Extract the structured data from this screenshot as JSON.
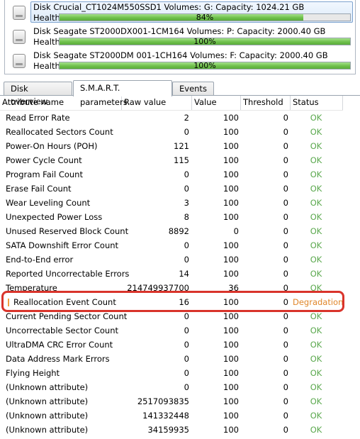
{
  "disks": [
    {
      "line": "Disk Crucial_CT1024M550SSD1   Volumes: G:   Capacity: 1024.21 GB",
      "health_label": "Health:",
      "health_text": "84%",
      "health": 0.84,
      "selected": true
    },
    {
      "line": "Disk Seagate ST2000DX001-1CM164   Volumes: P:   Capacity: 2000.40 GB",
      "health_label": "Health:",
      "health_text": "100%",
      "health": 1.0,
      "selected": false
    },
    {
      "line": "Disk Seagate ST2000DM 001-1CH164   Volumes: F:   Capacity: 2000.40 GB",
      "health_label": "Health:",
      "health_text": "100%",
      "health": 1.0,
      "selected": false
    }
  ],
  "tabs": [
    "Disk overview",
    "S.M.A.R.T. parameters",
    "Events"
  ],
  "active_tab": 1,
  "columns": {
    "name": "Attribute name",
    "raw": "Raw value",
    "value": "Value",
    "threshold": "Threshold",
    "status": "Status"
  },
  "rows": [
    {
      "name": "Read Error Rate",
      "raw": "2",
      "value": "100",
      "threshold": "0",
      "status": "OK"
    },
    {
      "name": "Reallocated Sectors Count",
      "raw": "0",
      "value": "100",
      "threshold": "0",
      "status": "OK"
    },
    {
      "name": "Power-On Hours (POH)",
      "raw": "121",
      "value": "100",
      "threshold": "0",
      "status": "OK"
    },
    {
      "name": "Power Cycle Count",
      "raw": "115",
      "value": "100",
      "threshold": "0",
      "status": "OK"
    },
    {
      "name": "Program Fail Count",
      "raw": "0",
      "value": "100",
      "threshold": "0",
      "status": "OK"
    },
    {
      "name": "Erase Fail Count",
      "raw": "0",
      "value": "100",
      "threshold": "0",
      "status": "OK"
    },
    {
      "name": "Wear Leveling Count",
      "raw": "3",
      "value": "100",
      "threshold": "0",
      "status": "OK"
    },
    {
      "name": "Unexpected Power Loss",
      "raw": "8",
      "value": "100",
      "threshold": "0",
      "status": "OK"
    },
    {
      "name": "Unused Reserved Block Count",
      "raw": "8892",
      "value": "0",
      "threshold": "0",
      "status": "OK"
    },
    {
      "name": "SATA Downshift Error Count",
      "raw": "0",
      "value": "100",
      "threshold": "0",
      "status": "OK"
    },
    {
      "name": "End-to-End error",
      "raw": "0",
      "value": "100",
      "threshold": "0",
      "status": "OK"
    },
    {
      "name": "Reported Uncorrectable Errors",
      "raw": "14",
      "value": "100",
      "threshold": "0",
      "status": "OK"
    },
    {
      "name": "Temperature",
      "raw": "214749937700",
      "value": "36",
      "threshold": "0",
      "status": "OK"
    },
    {
      "name": "Reallocation Event Count",
      "raw": "16",
      "value": "100",
      "threshold": "0",
      "status": "Degradation",
      "warning": true
    },
    {
      "name": "Current Pending Sector Count",
      "raw": "0",
      "value": "100",
      "threshold": "0",
      "status": "OK"
    },
    {
      "name": "Uncorrectable Sector Count",
      "raw": "0",
      "value": "100",
      "threshold": "0",
      "status": "OK"
    },
    {
      "name": "UltraDMA CRC Error Count",
      "raw": "0",
      "value": "100",
      "threshold": "0",
      "status": "OK"
    },
    {
      "name": "Data Address Mark Errors",
      "raw": "0",
      "value": "100",
      "threshold": "0",
      "status": "OK"
    },
    {
      "name": "Flying Height",
      "raw": "0",
      "value": "100",
      "threshold": "0",
      "status": "OK"
    },
    {
      "name": "(Unknown attribute)",
      "raw": "0",
      "value": "100",
      "threshold": "0",
      "status": "OK"
    },
    {
      "name": "(Unknown attribute)",
      "raw": "2517093835",
      "value": "100",
      "threshold": "0",
      "status": "OK"
    },
    {
      "name": "(Unknown attribute)",
      "raw": "141332448",
      "value": "100",
      "threshold": "0",
      "status": "OK"
    },
    {
      "name": "(Unknown attribute)",
      "raw": "34159935",
      "value": "100",
      "threshold": "0",
      "status": "OK"
    }
  ],
  "colors": {
    "ok": "#5aa84d",
    "degradation": "#e0862a",
    "highlight": "#d9342b",
    "health_bar": "#6fc04c"
  }
}
